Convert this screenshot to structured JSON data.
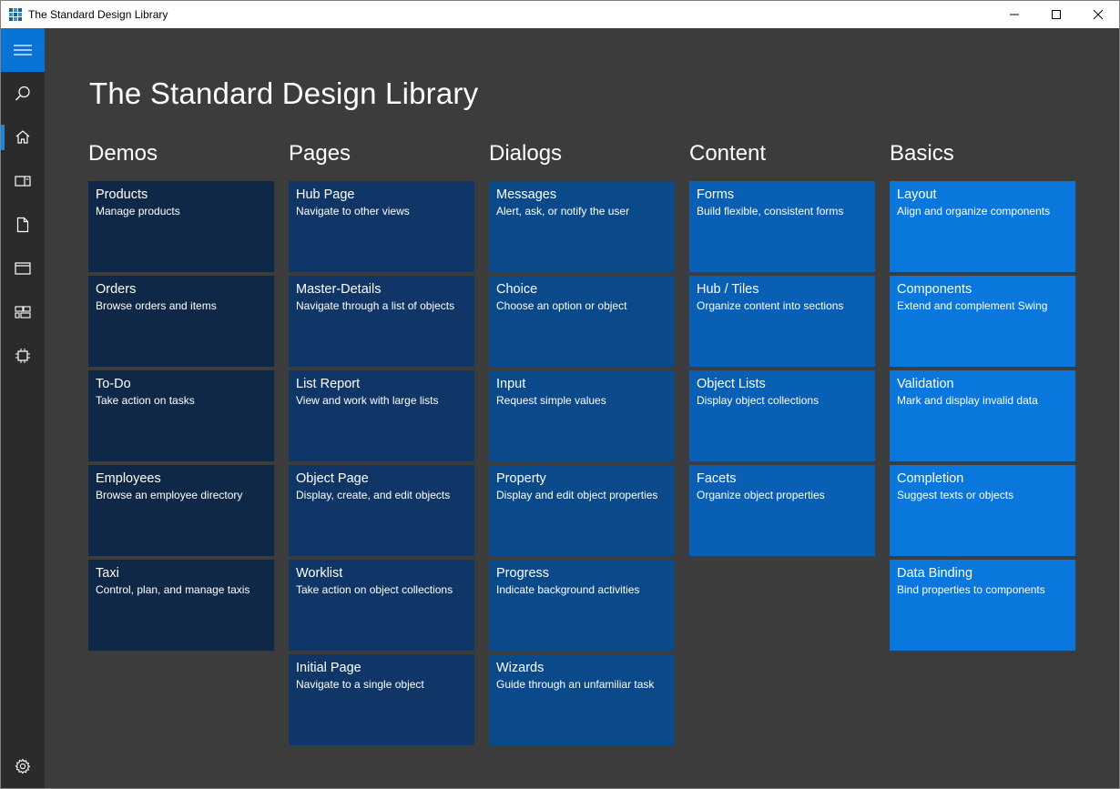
{
  "window": {
    "title": "The Standard Design Library",
    "controls": [
      "minimize-icon",
      "maximize-icon",
      "close-icon"
    ]
  },
  "sidebar": {
    "items": [
      {
        "name": "menu",
        "icon": "hamburger-icon"
      },
      {
        "name": "search",
        "icon": "search-icon"
      },
      {
        "name": "home",
        "icon": "home-icon",
        "selected": true
      },
      {
        "name": "demos",
        "icon": "panel-icon"
      },
      {
        "name": "pages",
        "icon": "page-icon"
      },
      {
        "name": "dialogs",
        "icon": "window-icon"
      },
      {
        "name": "content",
        "icon": "tiles-icon"
      },
      {
        "name": "basics",
        "icon": "chip-icon"
      },
      {
        "name": "settings",
        "icon": "gear-icon"
      }
    ],
    "accent": "#0a74d6"
  },
  "main": {
    "title": "The Standard Design Library",
    "columns": [
      {
        "header": "Demos",
        "color": "#102848",
        "tiles": [
          {
            "title": "Products",
            "subtitle": "Manage products"
          },
          {
            "title": "Orders",
            "subtitle": "Browse orders and items"
          },
          {
            "title": "To-Do",
            "subtitle": "Take action on tasks"
          },
          {
            "title": "Employees",
            "subtitle": "Browse an employee directory"
          },
          {
            "title": "Taxi",
            "subtitle": "Control, plan, and manage taxis"
          }
        ]
      },
      {
        "header": "Pages",
        "color": "#0f3667",
        "tiles": [
          {
            "title": "Hub Page",
            "subtitle": "Navigate to other views"
          },
          {
            "title": "Master-Details",
            "subtitle": "Navigate through a list of objects"
          },
          {
            "title": "List Report",
            "subtitle": "View and work with large lists"
          },
          {
            "title": "Object Page",
            "subtitle": "Display, create, and edit objects"
          },
          {
            "title": "Worklist",
            "subtitle": "Take action on object collections"
          },
          {
            "title": "Initial Page",
            "subtitle": "Navigate to a single object"
          }
        ]
      },
      {
        "header": "Dialogs",
        "color": "#0a4a8a",
        "tiles": [
          {
            "title": "Messages",
            "subtitle": "Alert, ask, or notify the user"
          },
          {
            "title": "Choice",
            "subtitle": "Choose an option or object"
          },
          {
            "title": "Input",
            "subtitle": "Request simple values"
          },
          {
            "title": "Property",
            "subtitle": "Display and edit object properties"
          },
          {
            "title": "Progress",
            "subtitle": "Indicate background activities"
          },
          {
            "title": "Wizards",
            "subtitle": "Guide through an unfamiliar task"
          }
        ]
      },
      {
        "header": "Content",
        "color": "#085fb3",
        "tiles": [
          {
            "title": "Forms",
            "subtitle": "Build flexible, consistent forms"
          },
          {
            "title": "Hub / Tiles",
            "subtitle": "Organize content into sections"
          },
          {
            "title": "Object Lists",
            "subtitle": "Display object collections"
          },
          {
            "title": "Facets",
            "subtitle": "Organize object properties"
          }
        ]
      },
      {
        "header": "Basics",
        "color": "#0a77dc",
        "tiles": [
          {
            "title": "Layout",
            "subtitle": "Align and organize components"
          },
          {
            "title": "Components",
            "subtitle": "Extend and complement Swing"
          },
          {
            "title": "Validation",
            "subtitle": "Mark and display invalid data"
          },
          {
            "title": "Completion",
            "subtitle": "Suggest texts or objects"
          },
          {
            "title": "Data Binding",
            "subtitle": "Bind properties to components"
          }
        ]
      }
    ]
  }
}
